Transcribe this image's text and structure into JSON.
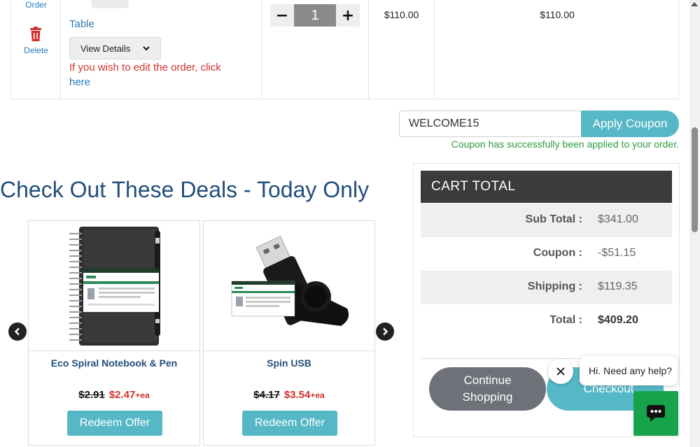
{
  "order_row": {
    "order_link": "Order",
    "delete_link": "Delete",
    "product_name": "Table",
    "view_details_label": "View Details",
    "edit_note": "If you wish to edit the order, click",
    "edit_link": "here",
    "quantity": "1",
    "minus_label": "−",
    "plus_label": "+",
    "unit_price": "$110.00",
    "line_total": "$110.00"
  },
  "coupon": {
    "code": "WELCOME15",
    "apply_label": "Apply Coupon",
    "success_message": "Coupon has successfully been applied to your order."
  },
  "deals": {
    "title": "Check Out These Deals - Today Only",
    "items": [
      {
        "name": "Eco Spiral Notebook & Pen",
        "old_price": "$2.91",
        "new_price": "$2.47",
        "unit": "+ea",
        "button": "Redeem Offer"
      },
      {
        "name": "Spin USB",
        "old_price": "$4.17",
        "new_price": "$3.54",
        "unit": "+ea",
        "button": "Redeem Offer"
      }
    ]
  },
  "cart_total": {
    "title": "CART  TOTAL",
    "rows": [
      {
        "label": "Sub Total :",
        "value": "$341.00"
      },
      {
        "label": "Coupon :",
        "value": "-$51.15"
      },
      {
        "label": "Shipping :",
        "value": "$119.35"
      },
      {
        "label": "Total :",
        "value": "$409.20"
      }
    ],
    "continue_label_line1": "Continue",
    "continue_label_line2": "Shopping",
    "checkout_label": "Checkout"
  },
  "chat": {
    "greeting": "Hi. Need any help?"
  },
  "colors": {
    "accent": "#56b7c6",
    "heading_blue": "#224e7b",
    "link_blue": "#2a7ab8",
    "error_red": "#d0312d",
    "success_green": "#2e9b3f",
    "chat_green": "#16a34a"
  },
  "icons": [
    "trash-icon",
    "chevron-down-icon",
    "chevron-left-icon",
    "chevron-right-icon",
    "close-icon",
    "chat-icon"
  ]
}
